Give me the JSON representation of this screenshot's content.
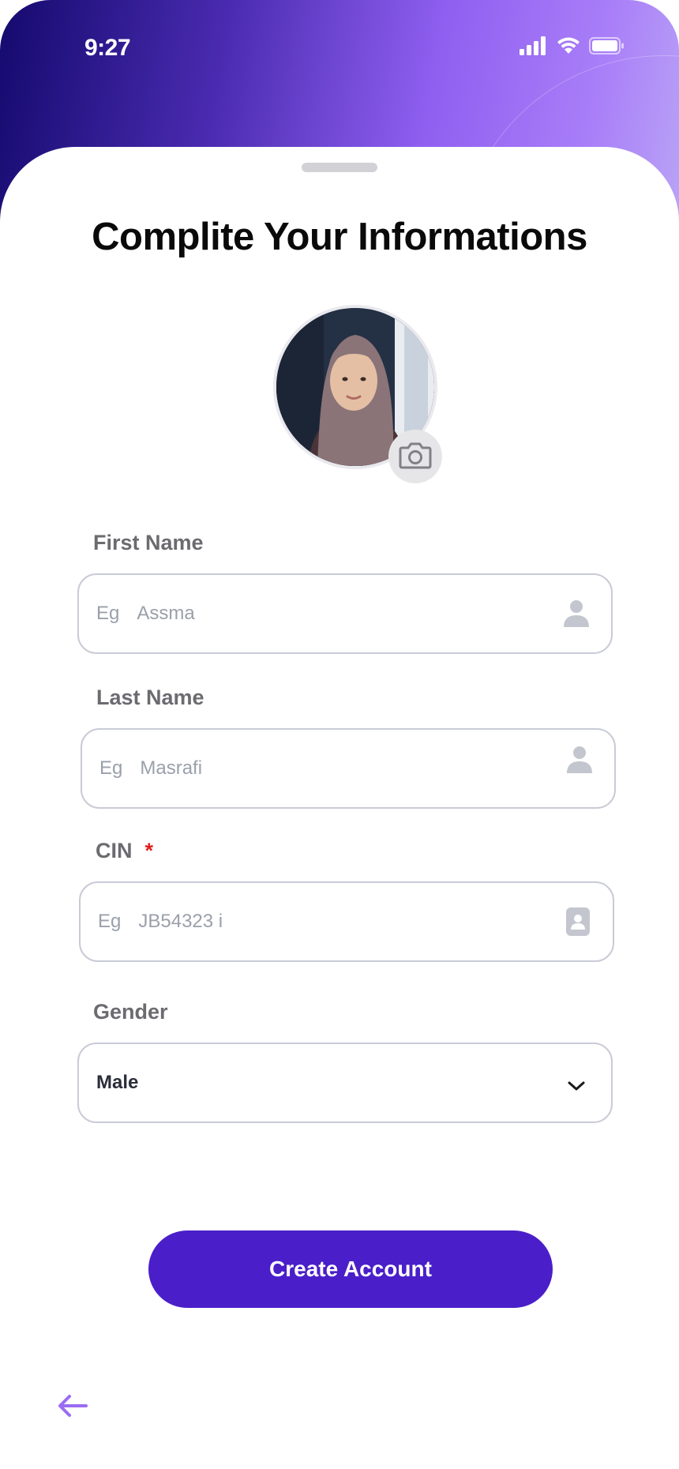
{
  "status_bar": {
    "time": "9:27",
    "signal_icon": "cellular-signal-icon",
    "wifi_icon": "wifi-icon",
    "battery_icon": "battery-icon"
  },
  "header": {
    "gradient_colors": [
      "#140a6e",
      "#8f5ff0",
      "#b9a4f6"
    ]
  },
  "page": {
    "title": "Complite Your Informations"
  },
  "profile": {
    "avatar_kind": "profile-photo",
    "camera_icon": "camera-icon"
  },
  "form": {
    "first_name": {
      "label": "First Name",
      "prefix": "Eg",
      "placeholder": "Assma",
      "icon": "person-icon"
    },
    "last_name": {
      "label": "Last Name",
      "prefix": "Eg",
      "placeholder": "Masrafi",
      "icon": "person-icon"
    },
    "cin": {
      "label": "CIN",
      "required_mark": "*",
      "prefix": "Eg",
      "placeholder": "JB54323 i",
      "icon": "id-card-icon"
    },
    "gender": {
      "label": "Gender",
      "selected": "Male",
      "icon": "chevron-down-icon"
    }
  },
  "actions": {
    "create_account": "Create Account",
    "back_icon": "arrow-left-icon"
  },
  "colors": {
    "primary": "#4a1fc9",
    "required": "#e11d1d",
    "back_arrow": "#9b6cf2"
  }
}
